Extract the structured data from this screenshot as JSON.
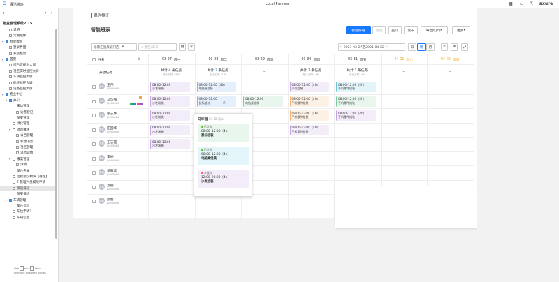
{
  "topbar": {
    "page_name": "保洁排班",
    "center_title": "Local Preview",
    "logo": "axure"
  },
  "sidebar": {
    "project": "物业管理系统2.15",
    "hint_line1": "Use",
    "hint_and": "and",
    "hint_keys": "keys",
    "hint_line2": "to move between pages",
    "items": [
      {
        "label": "说明",
        "level": 1,
        "type": "page"
      },
      {
        "label": "常用组件",
        "level": 1,
        "type": "page"
      },
      {
        "label": "框架模板",
        "level": 0,
        "type": "folder",
        "open": true
      },
      {
        "label": "登录界面",
        "level": 1,
        "type": "page"
      },
      {
        "label": "系统框架",
        "level": 1,
        "type": "page"
      },
      {
        "label": "首页",
        "level": 0,
        "type": "folder",
        "open": true
      },
      {
        "label": "综合可视化大屏",
        "level": 1,
        "type": "page"
      },
      {
        "label": "社区实时监控大屏",
        "level": 1,
        "type": "page"
      },
      {
        "label": "车辆监控大屏",
        "level": 1,
        "type": "page"
      },
      {
        "label": "能耗监控大屏",
        "level": 1,
        "type": "page"
      },
      {
        "label": "设备监控大屏",
        "level": 1,
        "type": "page"
      },
      {
        "label": "物业中心",
        "level": 0,
        "type": "folder",
        "open": true
      },
      {
        "label": "办公",
        "level": 1,
        "type": "folder",
        "open": true
      },
      {
        "label": "来访管理",
        "level": 2,
        "type": "page"
      },
      {
        "label": "访客登记",
        "level": 3,
        "type": "page"
      },
      {
        "label": "保安管理",
        "level": 2,
        "type": "page"
      },
      {
        "label": "绿化管理",
        "level": 2,
        "type": "page"
      },
      {
        "label": "消息推送",
        "level": 2,
        "type": "page",
        "open": true
      },
      {
        "label": "公告管理",
        "level": 3,
        "type": "page"
      },
      {
        "label": "新建消息",
        "level": 3,
        "type": "page"
      },
      {
        "label": "社区管理",
        "level": 3,
        "type": "page"
      },
      {
        "label": "消息详情",
        "level": 3,
        "type": "page"
      },
      {
        "label": "报案管理",
        "level": 2,
        "type": "page",
        "open": true
      },
      {
        "label": "详情",
        "level": 3,
        "type": "page"
      },
      {
        "label": "单位名录",
        "level": 2,
        "type": "page"
      },
      {
        "label": "远程会议模块【待定】",
        "level": 2,
        "type": "page"
      },
      {
        "label": "7 管理人员模块申请",
        "level": 2,
        "type": "page"
      },
      {
        "label": "保洁排班",
        "level": 2,
        "type": "page",
        "selected": true
      },
      {
        "label": "保安排班",
        "level": 2,
        "type": "page"
      },
      {
        "label": "车辆管理",
        "level": 1,
        "type": "folder",
        "open": true
      },
      {
        "label": "车位信息",
        "level": 2,
        "type": "page"
      },
      {
        "label": "车位申请?",
        "level": 2,
        "type": "page"
      },
      {
        "label": "车辆信息",
        "level": 2,
        "type": "page"
      }
    ]
  },
  "main": {
    "breadcrumb": "保洁排班",
    "heading": "智能班表",
    "buttons": {
      "smart": "智能排班",
      "pause": "暂存",
      "submit": "提交",
      "publish": "发布",
      "export": "导出/打印",
      "more": "更多"
    },
    "store_select": "徐家汇星辰城门店",
    "search_placeholder": "姓名/工号",
    "date_range": "2021-03-27至2021-04-02",
    "view_day": "日",
    "view_week": "周",
    "view_month": "月",
    "col_name": "姓名",
    "row_open": "开放任务",
    "days": [
      {
        "date": "03-27",
        "week": "周一",
        "summary_pre": "共计",
        "count": "4",
        "summary_post": "条任务",
        "sub": "总计工时：48h"
      },
      {
        "date": "03-28",
        "week": "周二",
        "summary_pre": "共计",
        "count": "2",
        "summary_post": "条任务",
        "sub": "总计工时：48h"
      },
      {
        "date": "03-29",
        "week": "周三",
        "summary": "–"
      },
      {
        "date": "03-30",
        "week": "周四",
        "summary_pre": "共计",
        "count": "1",
        "summary_post": "条任务",
        "sub": "总计工时：4h"
      },
      {
        "date": "03-31",
        "week": "周五",
        "summary_pre": "共计",
        "count": "3",
        "summary_post": "条任务",
        "sub": "总计工时：8h"
      },
      {
        "date": "04-01",
        "week": "周六",
        "summary": "–"
      },
      {
        "date": "04-02",
        "week": "周日",
        "summary": "–"
      }
    ],
    "staff": [
      {
        "name": "王伟",
        "id": "JK000084",
        "avatar": "王伟"
      },
      {
        "name": "马华强",
        "id": "JK000084",
        "avatar": "马华"
      },
      {
        "name": "张志伟",
        "id": "JK000084",
        "avatar": "志伟"
      },
      {
        "name": "田国华",
        "id": "JK000084",
        "avatar": "国华"
      },
      {
        "name": "王志韶",
        "id": "JK000084",
        "avatar": "志韶"
      },
      {
        "name": "李婷",
        "id": "JK000084",
        "avatar": "李婷"
      },
      {
        "name": "黎嘉蕊",
        "id": "JK000084",
        "avatar": "嘉蕊"
      },
      {
        "name": "苏钢",
        "id": "JK000084",
        "avatar": "苏钢"
      },
      {
        "name": "邵磊",
        "id": "JK000084",
        "avatar": "邵磊"
      }
    ],
    "shifts": [
      {
        "row": 0,
        "col": 0,
        "time": "08:00–12:00",
        "task": "沙发端装",
        "color": "pv"
      },
      {
        "row": 0,
        "col": 1,
        "time": "08:00–12:00（4h）",
        "task": "电脑桌组装",
        "color": "bl"
      },
      {
        "row": 0,
        "col": 3,
        "time": "08:00–12:00（4h）",
        "task": "沙发组装",
        "color": "pv"
      },
      {
        "row": 0,
        "col": 4,
        "time": "08:00–12:00（4h）",
        "task": "手机零件组装",
        "color": "cy"
      },
      {
        "row": 1,
        "col": 0,
        "time": "08:00–12:00",
        "task": "沙发端装",
        "color": "pv"
      },
      {
        "row": 1,
        "col": 1,
        "time": "08:00–12:00",
        "task": "鼠标组装",
        "color": "bl"
      },
      {
        "row": 1,
        "col": 2,
        "time": "08:00–12:00",
        "task": "电脑桌组装",
        "color": "gr"
      },
      {
        "row": 1,
        "col": 3,
        "time": "08:00–12:00（4h）",
        "task": "手机零件组装",
        "color": "og"
      },
      {
        "row": 1,
        "col": 4,
        "time": "08:00–12:00（4h）",
        "task": "手机零件组装",
        "color": "gr"
      },
      {
        "row": 2,
        "col": 0,
        "time": "08:00–12:00",
        "task": "沙发端装",
        "color": "pv"
      },
      {
        "row": 2,
        "col": 3,
        "time": "08:00–12:00（4h）",
        "task": "手机零件组装",
        "color": "og"
      },
      {
        "row": 2,
        "col": 4,
        "time": "08:00–12:00（4h）",
        "task": "手机零件组装",
        "color": "pv"
      },
      {
        "row": 3,
        "col": 0,
        "time": "08:00–12:00",
        "task": "沙发端装",
        "color": "pv"
      },
      {
        "row": 3,
        "col": 3,
        "time": "08:00–12:00（4h）",
        "task": "手机零件组装",
        "color": "pv"
      },
      {
        "row": 4,
        "col": 0,
        "time": "08:00–12:00",
        "task": "沙发端装",
        "color": "pv"
      }
    ],
    "popup": {
      "name": "马华强",
      "date": "03-28 周二",
      "cards": [
        {
          "status": "已发布",
          "time": "08:00–12:00（4h）",
          "task": "鼠标组装",
          "color": "gr",
          "dot": "#52c41a"
        },
        {
          "status": "已发布",
          "time": "08:00–12:00（4h）",
          "task": "电脑桌组装",
          "color": "cy",
          "dot": "#52c41a"
        },
        {
          "status": "未保存",
          "time": "12:00–20:00（4h）",
          "task": "沙发组装",
          "color": "pv",
          "dot": "#ff4d4f"
        }
      ]
    }
  },
  "colors": {
    "primary": "#1677ff",
    "weekend": "#f5a623",
    "count": "#1677ff"
  }
}
